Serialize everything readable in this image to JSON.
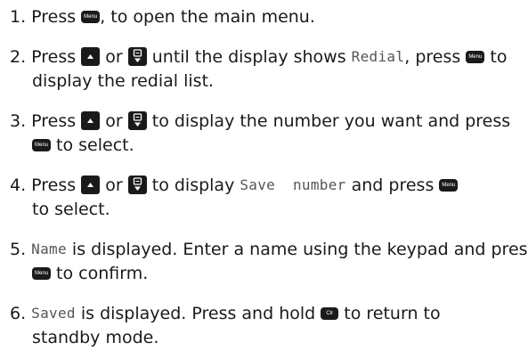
{
  "keys": {
    "menu": "Menu",
    "clear": "Clr"
  },
  "steps": [
    {
      "number": "1.",
      "parts": [
        "Press ",
        ", to open the main menu."
      ]
    },
    {
      "number": "2.",
      "parts": [
        "Press ",
        " or ",
        " until the display shows ",
        "Redial",
        ", press ",
        " to"
      ],
      "cont": "display the redial list."
    },
    {
      "number": "3.",
      "parts": [
        "Press ",
        " or ",
        " to display the number you want and press"
      ],
      "cont": " to select."
    },
    {
      "number": "4.",
      "parts": [
        "Press ",
        " or ",
        " to display ",
        "Save  number",
        " and press "
      ],
      "cont": "to select."
    },
    {
      "number": "5.",
      "parts": [
        "Name",
        " is displayed. Enter a name using the keypad and press"
      ],
      "cont": " to confirm."
    },
    {
      "number": "6.",
      "parts": [
        "Saved",
        " is displayed. Press and hold ",
        " to return to"
      ],
      "cont": "standby mode."
    }
  ]
}
